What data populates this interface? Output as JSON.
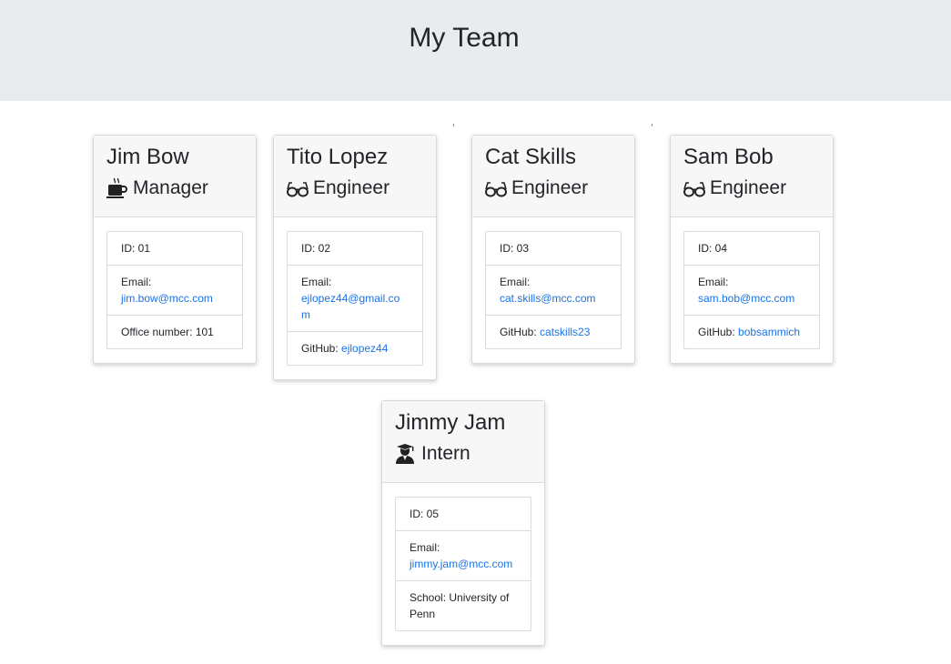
{
  "header": {
    "title": "My Team"
  },
  "labels": {
    "id_prefix": "ID: ",
    "email": "Email:",
    "office": "Office number: ",
    "github": "GitHub: ",
    "school": "School: "
  },
  "icons": {
    "manager": "coffee-mug-icon",
    "engineer": "glasses-icon",
    "intern": "graduate-icon"
  },
  "team": [
    {
      "name": "Jim Bow",
      "role": "Manager",
      "id": "01",
      "email": "jim.bow@mcc.com",
      "office_number": "101"
    },
    {
      "name": "Tito Lopez",
      "role": "Engineer",
      "id": "02",
      "email": "ejlopez44@gmail.com",
      "github": "ejlopez44"
    },
    {
      "name": "Cat Skills",
      "role": "Engineer",
      "id": "03",
      "email": "cat.skills@mcc.com",
      "github": "catskills23"
    },
    {
      "name": "Sam Bob",
      "role": "Engineer",
      "id": "04",
      "email": "sam.bob@mcc.com",
      "github": "bobsammich"
    },
    {
      "name": "Jimmy Jam",
      "role": "Intern",
      "id": "05",
      "email": "jimmy.jam@mcc.com",
      "school": "University of Penn"
    }
  ]
}
